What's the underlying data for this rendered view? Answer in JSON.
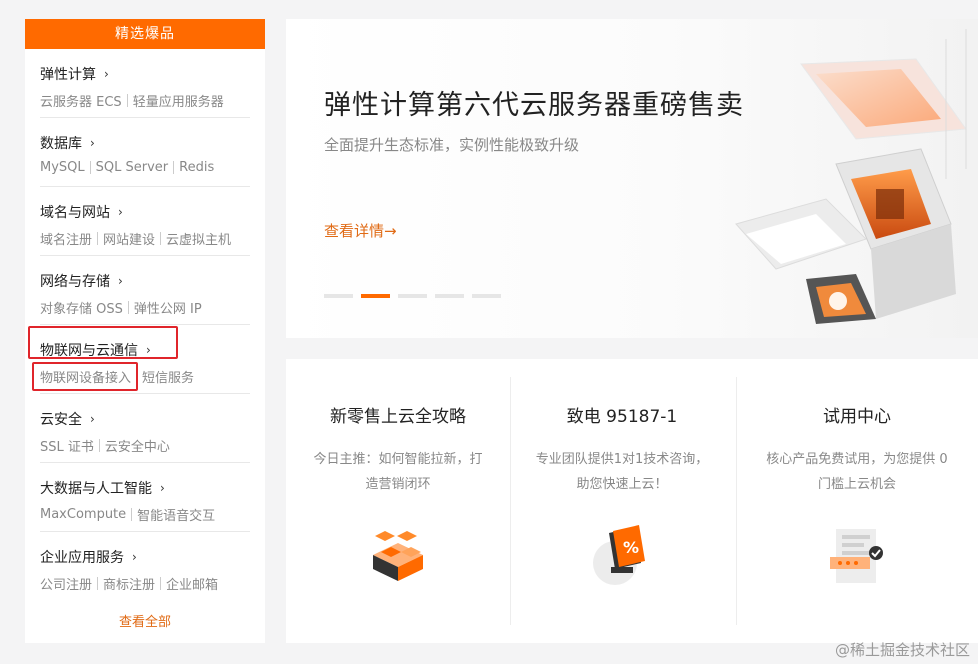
{
  "sidebar": {
    "header": "精选爆品",
    "categories": [
      {
        "title": "弹性计算",
        "links": [
          "云服务器 ECS",
          "轻量应用服务器"
        ]
      },
      {
        "title": "数据库",
        "links": [
          "MySQL",
          "SQL Server",
          "Redis"
        ]
      },
      {
        "title": "域名与网站",
        "links": [
          "域名注册",
          "网站建设",
          "云虚拟主机"
        ]
      },
      {
        "title": "网络与存储",
        "links": [
          "对象存储 OSS",
          "弹性公网 IP"
        ]
      },
      {
        "title": "物联网与云通信",
        "links": [
          "物联网设备接入",
          "短信服务"
        ]
      },
      {
        "title": "云安全",
        "links": [
          "SSL 证书",
          "云安全中心"
        ]
      },
      {
        "title": "大数据与人工智能",
        "links": [
          "MaxCompute",
          "智能语音交互"
        ]
      },
      {
        "title": "企业应用服务",
        "links": [
          "公司注册",
          "商标注册",
          "企业邮箱"
        ]
      }
    ],
    "view_all": "查看全部"
  },
  "banner": {
    "title": "弹性计算第六代云服务器重磅售卖",
    "subtitle": "全面提升生态标准，实例性能极致升级",
    "link": "查看详情",
    "arrow": "→",
    "dots_total": 5,
    "dots_active": 2
  },
  "cards": [
    {
      "title": "新零售上云全攻略",
      "desc": "今日主推：如何智能拉新，打造营销闭环",
      "icon": "cubes-icon"
    },
    {
      "title": "致电 95187-1",
      "desc": "专业团队提供1对1技术咨询，助您快速上云！",
      "icon": "coupon-percent-icon"
    },
    {
      "title": "试用中心",
      "desc": "核心产品免费试用，为您提供 0 门槛上云机会",
      "icon": "trial-document-icon"
    }
  ],
  "watermark": "@稀土掘金技术社区",
  "colors": {
    "accent": "#ff6a00",
    "link": "#e06a14",
    "highlight": "#e0252b"
  }
}
